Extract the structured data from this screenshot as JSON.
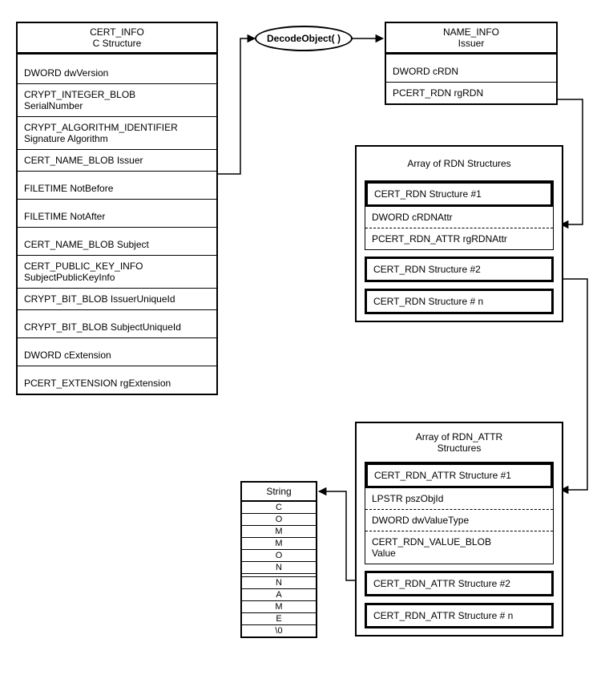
{
  "cert_info": {
    "title_line1": "CERT_INFO",
    "title_line2": "C Structure",
    "rows": [
      "DWORD dwVersion",
      "CRYPT_INTEGER_BLOB SerialNumber",
      "CRYPT_ALGORITHM_IDENTIFIER Signature Algorithm",
      "CERT_NAME_BLOB Issuer",
      "FILETIME NotBefore",
      "FILETIME NotAfter",
      "CERT_NAME_BLOB Subject",
      "CERT_PUBLIC_KEY_INFO SubjectPublicKeyInfo",
      "CRYPT_BIT_BLOB IssuerUniqueId",
      "CRYPT_BIT_BLOB SubjectUniqueId",
      "DWORD cExtension",
      "PCERT_EXTENSION rgExtension"
    ]
  },
  "decode_label": "DecodeObject( )",
  "name_info": {
    "title_line1": "NAME_INFO",
    "title_line2": "Issuer",
    "rows": [
      "DWORD  cRDN",
      "PCERT_RDN    rgRDN"
    ]
  },
  "rdn_array": {
    "title": "Array of RDN  Structures",
    "s1_title": "CERT_RDN Structure #1",
    "s1_rows": [
      "DWORD  cRDNAttr",
      "PCERT_RDN_ATTR  rgRDNAttr"
    ],
    "s2": "CERT_RDN Structure #2",
    "sn": "CERT_RDN Structure # n"
  },
  "rdn_attr_array": {
    "title_line1": "Array of RDN_ATTR",
    "title_line2": "Structures",
    "s1_title": "CERT_RDN_ATTR Structure #1",
    "s1_rows": [
      "LPSTR pszObjId",
      "DWORD dwValueType",
      "CERT_RDN_VALUE_BLOB Value"
    ],
    "s2": "CERT_RDN_ATTR Structure #2",
    "sn": "CERT_RDN_ATTR Structure # n"
  },
  "string_box": {
    "title": "String",
    "chars": [
      "C",
      "O",
      "M",
      "M",
      "O",
      "N",
      "",
      "N",
      "A",
      "M",
      "E",
      "\\0"
    ]
  }
}
